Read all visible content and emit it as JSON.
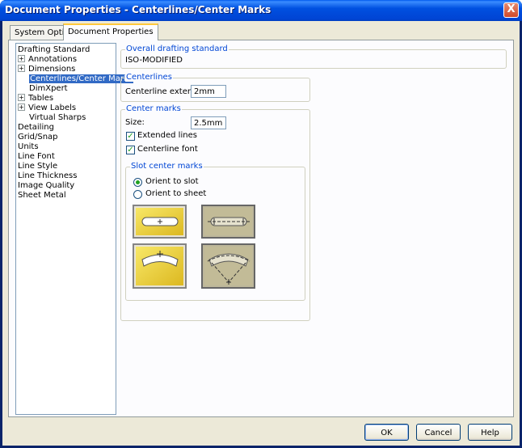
{
  "window": {
    "title": "Document Properties - Centerlines/Center Marks",
    "close_label": "X"
  },
  "tabs": [
    {
      "label": "System Options",
      "active": false
    },
    {
      "label": "Document Properties",
      "active": true
    }
  ],
  "tree": {
    "items": [
      {
        "label": "Drafting Standard",
        "expander": ""
      },
      {
        "label": "Annotations",
        "expander": "+"
      },
      {
        "label": "Dimensions",
        "expander": "+"
      },
      {
        "label": "Centerlines/Center Marks",
        "expander": "",
        "selected": true
      },
      {
        "label": "DimXpert",
        "expander": ""
      },
      {
        "label": "Tables",
        "expander": "+"
      },
      {
        "label": "View Labels",
        "expander": "+"
      },
      {
        "label": "Virtual Sharps",
        "expander": ""
      },
      {
        "label": "Detailing",
        "expander": ""
      },
      {
        "label": "Grid/Snap",
        "expander": ""
      },
      {
        "label": "Units",
        "expander": ""
      },
      {
        "label": "Line Font",
        "expander": ""
      },
      {
        "label": "Line Style",
        "expander": ""
      },
      {
        "label": "Line Thickness",
        "expander": ""
      },
      {
        "label": "Image Quality",
        "expander": ""
      },
      {
        "label": "Sheet Metal",
        "expander": ""
      }
    ]
  },
  "overall_standard": {
    "title": "Overall drafting standard",
    "value": "ISO-MODIFIED"
  },
  "centerlines": {
    "title": "Centerlines",
    "extension_label": "Centerline extension:",
    "extension_value": "2mm"
  },
  "center_marks": {
    "title": "Center marks",
    "size_label": "Size:",
    "size_value": "2.5mm",
    "extended_lines_label": "Extended lines",
    "extended_lines_checked": true,
    "centerline_font_label": "Centerline font",
    "centerline_font_checked": true
  },
  "slot_center_marks": {
    "title": "Slot center marks",
    "orient_to_slot_label": "Orient to slot",
    "orient_to_sheet_label": "Orient to sheet",
    "selected": "Orient to slot"
  },
  "buttons": {
    "ok": "OK",
    "cancel": "Cancel",
    "help": "Help"
  },
  "colors": {
    "title_bar": "#0054e3",
    "selection": "#316ac5",
    "group_title": "#0046d5",
    "tile_yellow": "#f2d53a"
  }
}
